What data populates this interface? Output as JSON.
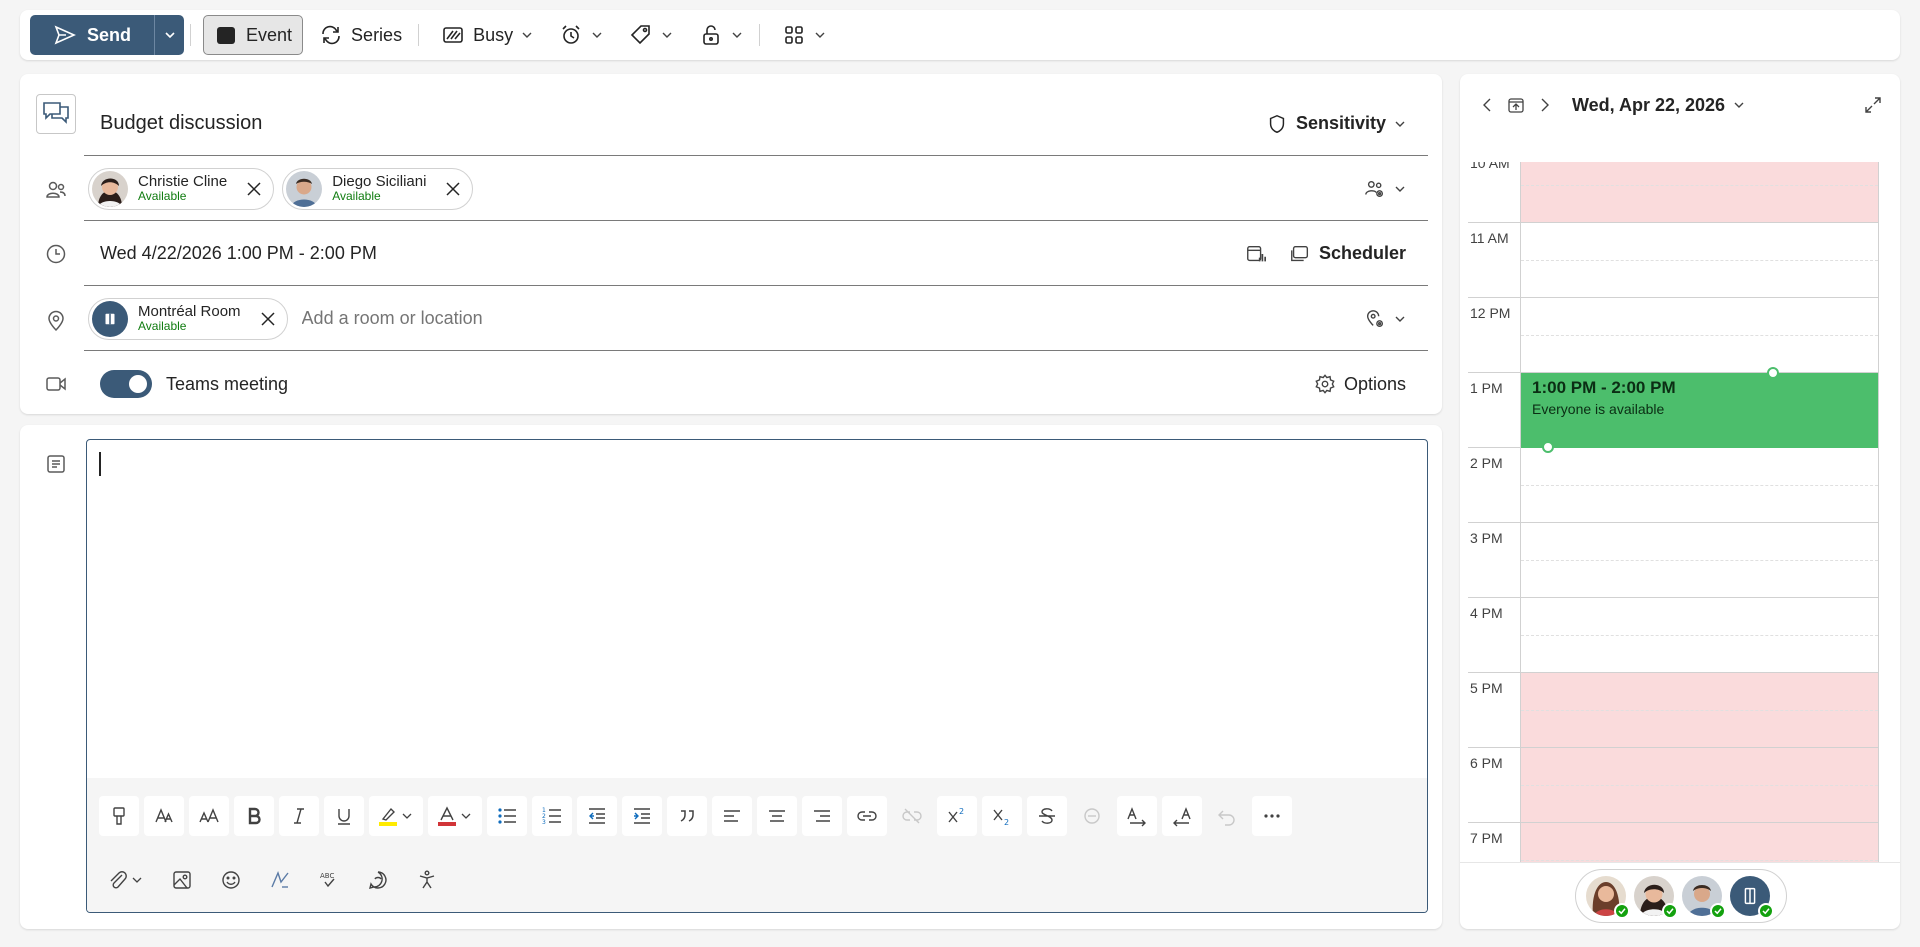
{
  "toolbar": {
    "send": "Send",
    "event": "Event",
    "series": "Series",
    "busy": "Busy"
  },
  "form": {
    "title": "Budget discussion",
    "sensitivity": "Sensitivity",
    "attendees": [
      {
        "name": "Christie Cline",
        "status": "Available"
      },
      {
        "name": "Diego Siciliani",
        "status": "Available"
      }
    ],
    "datetime": "Wed 4/22/2026 1:00 PM - 2:00 PM",
    "scheduler": "Scheduler",
    "room": {
      "name": "Montréal Room",
      "status": "Available"
    },
    "location_placeholder": "Add a room or location",
    "teams_label": "Teams meeting",
    "options": "Options"
  },
  "calendar": {
    "date": "Wed, Apr 22, 2026",
    "hours": [
      "10 AM",
      "11 AM",
      "12 PM",
      "1 PM",
      "2 PM",
      "3 PM",
      "4 PM",
      "5 PM",
      "6 PM",
      "7 PM"
    ],
    "event": {
      "time": "1:00 PM - 2:00 PM",
      "subtitle": "Everyone is available"
    }
  },
  "colors": {
    "accent": "#3b5a78",
    "available": "#107c10",
    "event_green": "#4cbe6c",
    "busy_pink": "#fadbdc"
  }
}
